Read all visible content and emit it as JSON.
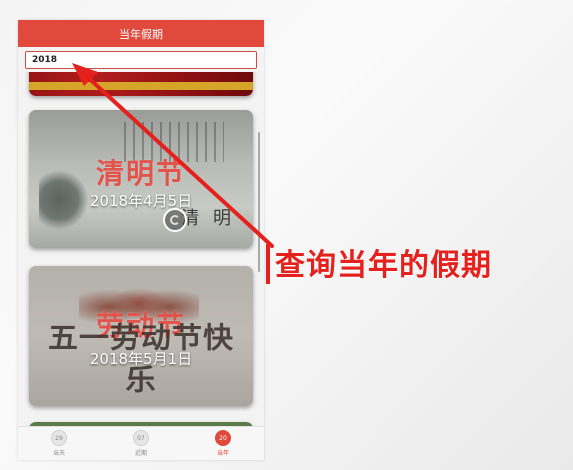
{
  "window": {
    "title": "当年假期"
  },
  "search": {
    "value": "2018"
  },
  "holidays": [
    {
      "name": "清明节",
      "date": "2018年4月5日",
      "deco_text": "清 明"
    },
    {
      "name": "劳动节",
      "date": "2018年5月1日",
      "deco_text": "五一劳动节快乐"
    }
  ],
  "tabs": [
    {
      "icon_text": "29",
      "label": "当天"
    },
    {
      "icon_text": "07",
      "label": "近期"
    },
    {
      "icon_text": "20",
      "label": "当年",
      "active": true
    }
  ],
  "annotation": {
    "text": "查询当年的假期"
  },
  "colors": {
    "accent": "#e0493b",
    "callout": "#e4211d"
  },
  "icons": {
    "media": "play-icon",
    "arrow": "arrow-icon"
  }
}
